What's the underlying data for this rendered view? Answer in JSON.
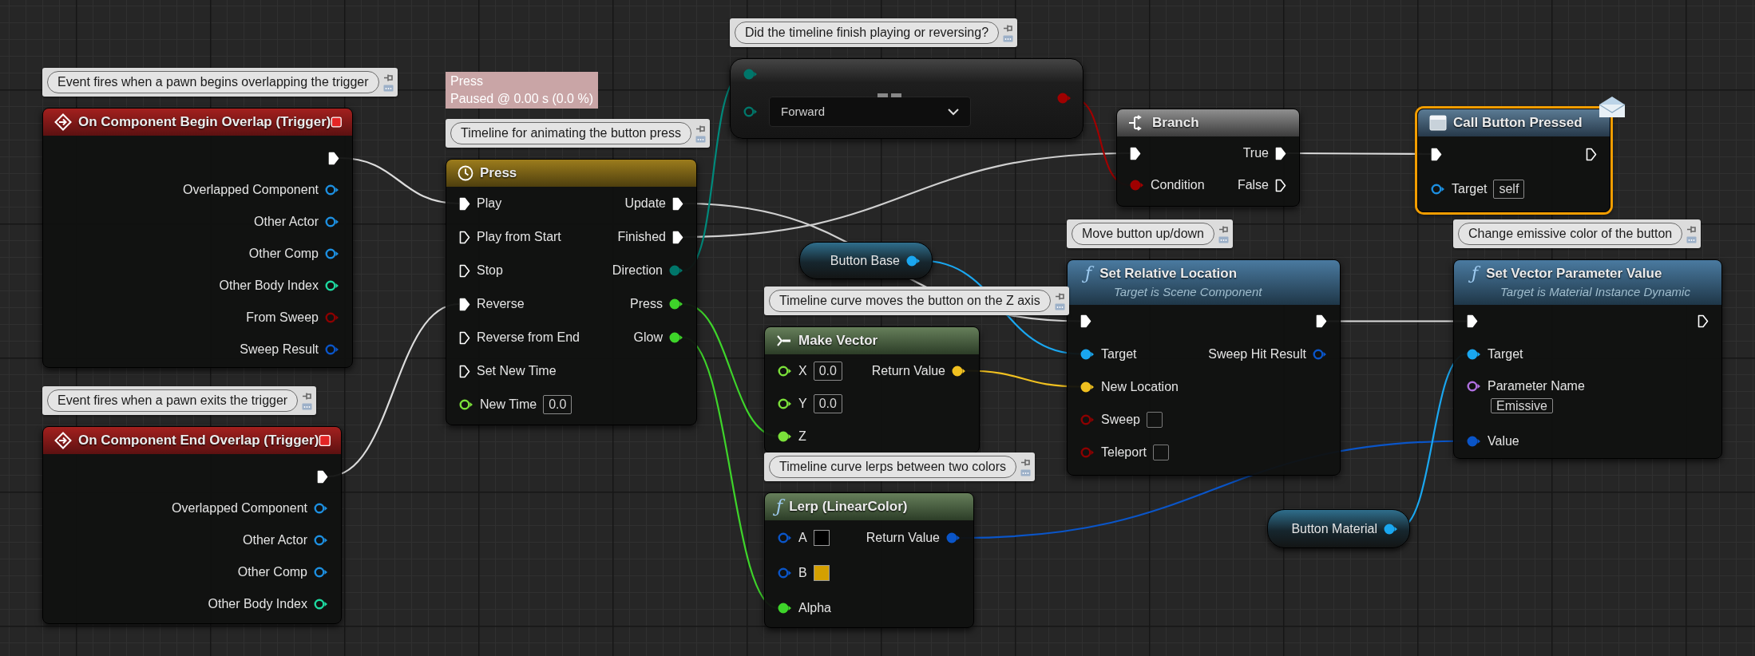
{
  "nodes": [
    {
      "kind": "event",
      "selected": false,
      "comment": "Event fires when a pawn begins overlapping the trigger",
      "title": "On Component Begin Overlap (Trigger)",
      "outputs": [
        {
          "kind": "exec",
          "connected": true
        },
        {
          "label": "Overlapped Component",
          "kind": "data",
          "color": "#1d8fe0",
          "connected": false
        },
        {
          "label": "Other Actor",
          "kind": "data",
          "color": "#1d8fe0",
          "connected": false
        },
        {
          "label": "Other Comp",
          "kind": "data",
          "color": "#1d8fe0",
          "connected": false
        },
        {
          "label": "Other Body Index",
          "kind": "data",
          "color": "#1ed9a0",
          "connected": false
        },
        {
          "label": "From Sweep",
          "kind": "data",
          "color": "#8c0000",
          "connected": false
        },
        {
          "label": "Sweep Result",
          "kind": "data",
          "color": "#0a55c8",
          "connected": false
        }
      ]
    },
    {
      "kind": "event",
      "selected": false,
      "comment": "Event fires when a pawn exits the trigger",
      "title": "On Component End Overlap (Trigger)",
      "outputs": [
        {
          "kind": "exec",
          "connected": true
        },
        {
          "label": "Overlapped Component",
          "kind": "data",
          "color": "#1d8fe0",
          "connected": false
        },
        {
          "label": "Other Actor",
          "kind": "data",
          "color": "#1d8fe0",
          "connected": false
        },
        {
          "label": "Other Comp",
          "kind": "data",
          "color": "#1d8fe0",
          "connected": false
        },
        {
          "label": "Other Body Index",
          "kind": "data",
          "color": "#1ed9a0",
          "connected": false
        }
      ]
    },
    {
      "kind": "timeline",
      "selected": false,
      "status": [
        "Press",
        "Paused @ 0.00 s (0.0 %)"
      ],
      "comment": "Timeline for animating the button press",
      "title": "Press",
      "inputs": [
        {
          "label": "Play",
          "kind": "exec",
          "connected": true
        },
        {
          "label": "Play from Start",
          "kind": "exec",
          "connected": false
        },
        {
          "label": "Stop",
          "kind": "exec",
          "connected": false
        },
        {
          "label": "Reverse",
          "kind": "exec",
          "connected": true
        },
        {
          "label": "Reverse from End",
          "kind": "exec",
          "connected": false
        },
        {
          "label": "Set New Time",
          "kind": "exec",
          "connected": false
        },
        {
          "label": "New Time",
          "kind": "data",
          "color": "#7be03a",
          "connected": false,
          "field": {
            "kind": "text",
            "value": "0.0"
          }
        }
      ],
      "outputs": [
        {
          "label": "Update",
          "kind": "exec",
          "connected": true
        },
        {
          "label": "Finished",
          "kind": "exec",
          "connected": true
        },
        {
          "label": "Direction",
          "kind": "data",
          "color": "#00766a",
          "connected": true
        },
        {
          "label": "Press",
          "kind": "data",
          "color": "#3ed42a",
          "connected": true
        },
        {
          "label": "Glow",
          "kind": "data",
          "color": "#3ed42a",
          "connected": true
        }
      ]
    },
    {
      "kind": "select",
      "selected": false,
      "comment": "Did the timeline finish playing or reversing?",
      "inputs": [
        {
          "kind": "data",
          "color": "#00766a",
          "connected": true
        },
        {
          "kind": "data",
          "color": "#00766a",
          "connected": false,
          "field": {
            "kind": "dropdown",
            "value": "Forward"
          }
        }
      ],
      "outputs": [
        {
          "kind": "data",
          "color": "#a00000",
          "connected": true
        }
      ]
    },
    {
      "kind": "branch",
      "selected": false,
      "title": "Branch",
      "inputs": [
        {
          "kind": "exec",
          "connected": true
        },
        {
          "label": "Condition",
          "kind": "data",
          "color": "#a00000",
          "connected": true
        }
      ],
      "outputs": [
        {
          "label": "True",
          "kind": "exec",
          "connected": true
        },
        {
          "label": "False",
          "kind": "exec",
          "connected": false
        }
      ]
    },
    {
      "kind": "message",
      "selected": true,
      "title": "Call Button Pressed",
      "inputs": [
        {
          "kind": "exec",
          "connected": true
        },
        {
          "label": "Target",
          "kind": "data",
          "color": "#1d8fe0",
          "connected": false,
          "field": {
            "kind": "text",
            "value": "self"
          }
        }
      ],
      "outputs": [
        {
          "kind": "exec",
          "connected": false
        }
      ]
    },
    {
      "kind": "variable",
      "selected": false,
      "outputs": [
        {
          "label": "Button Base",
          "kind": "data",
          "color": "#1aa7f0",
          "connected": true
        }
      ]
    },
    {
      "kind": "function",
      "selected": false,
      "comment": "Move button up/down",
      "icon": "ƒ",
      "title": "Set Relative Location",
      "subtitle": "Target is Scene Component",
      "inputs": [
        {
          "kind": "exec",
          "connected": true
        },
        {
          "label": "Target",
          "kind": "data",
          "color": "#1aa7f0",
          "connected": true
        },
        {
          "label": "New Location",
          "kind": "data",
          "color": "#f0c020",
          "connected": true
        },
        {
          "label": "Sweep",
          "kind": "data",
          "color": "#8c0000",
          "connected": false,
          "field": {
            "kind": "checkbox",
            "checked": false
          }
        },
        {
          "label": "Teleport",
          "kind": "data",
          "color": "#8c0000",
          "connected": false,
          "field": {
            "kind": "checkbox",
            "checked": false
          }
        }
      ],
      "outputs": [
        {
          "kind": "exec",
          "connected": true
        },
        {
          "label": "Sweep Hit Result",
          "kind": "data",
          "color": "#0a55c8",
          "connected": false
        }
      ]
    },
    {
      "kind": "pure",
      "selected": false,
      "comment": "Timeline curve moves the button on the Z axis",
      "title": "Make Vector",
      "inputs": [
        {
          "label": "X",
          "kind": "data",
          "color": "#7be03a",
          "connected": false,
          "field": {
            "kind": "text",
            "value": "0.0"
          }
        },
        {
          "label": "Y",
          "kind": "data",
          "color": "#7be03a",
          "connected": false,
          "field": {
            "kind": "text",
            "value": "0.0"
          }
        },
        {
          "label": "Z",
          "kind": "data",
          "color": "#7be03a",
          "connected": true
        }
      ],
      "outputs": [
        {
          "label": "Return Value",
          "kind": "data",
          "color": "#f0c020",
          "connected": true
        }
      ]
    },
    {
      "kind": "pure",
      "selected": false,
      "comment": "Timeline curve lerps between two colors",
      "icon": "ƒ",
      "title": "Lerp (LinearColor)",
      "inputs": [
        {
          "label": "A",
          "kind": "data",
          "color": "#0a55c8",
          "connected": false,
          "field": {
            "kind": "swatch",
            "color": "#000000"
          }
        },
        {
          "label": "B",
          "kind": "data",
          "color": "#0a55c8",
          "connected": false,
          "field": {
            "kind": "swatch",
            "color": "#d4a000"
          }
        },
        {
          "label": "Alpha",
          "kind": "data",
          "color": "#3ed42a",
          "connected": true
        }
      ],
      "outputs": [
        {
          "label": "Return Value",
          "kind": "data",
          "color": "#0a55c8",
          "connected": true
        }
      ]
    },
    {
      "kind": "function",
      "selected": false,
      "comment": "Change emissive color of the button",
      "icon": "ƒ",
      "title": "Set Vector Parameter Value",
      "subtitle": "Target is Material Instance Dynamic",
      "inputs": [
        {
          "kind": "exec",
          "connected": true
        },
        {
          "label": "Target",
          "kind": "data",
          "color": "#1aa7f0",
          "connected": true
        },
        {
          "label": "Parameter Name",
          "kind": "data",
          "color": "#b070e0",
          "connected": false,
          "field": {
            "kind": "text_below",
            "value": "Emissive"
          }
        },
        {
          "label": "Value",
          "kind": "data",
          "color": "#0a55c8",
          "connected": true
        }
      ],
      "outputs": [
        {
          "kind": "exec",
          "connected": false
        }
      ]
    },
    {
      "kind": "variable",
      "selected": false,
      "outputs": [
        {
          "label": "Button Material",
          "kind": "data",
          "color": "#1aa7f0",
          "connected": true
        }
      ]
    }
  ]
}
